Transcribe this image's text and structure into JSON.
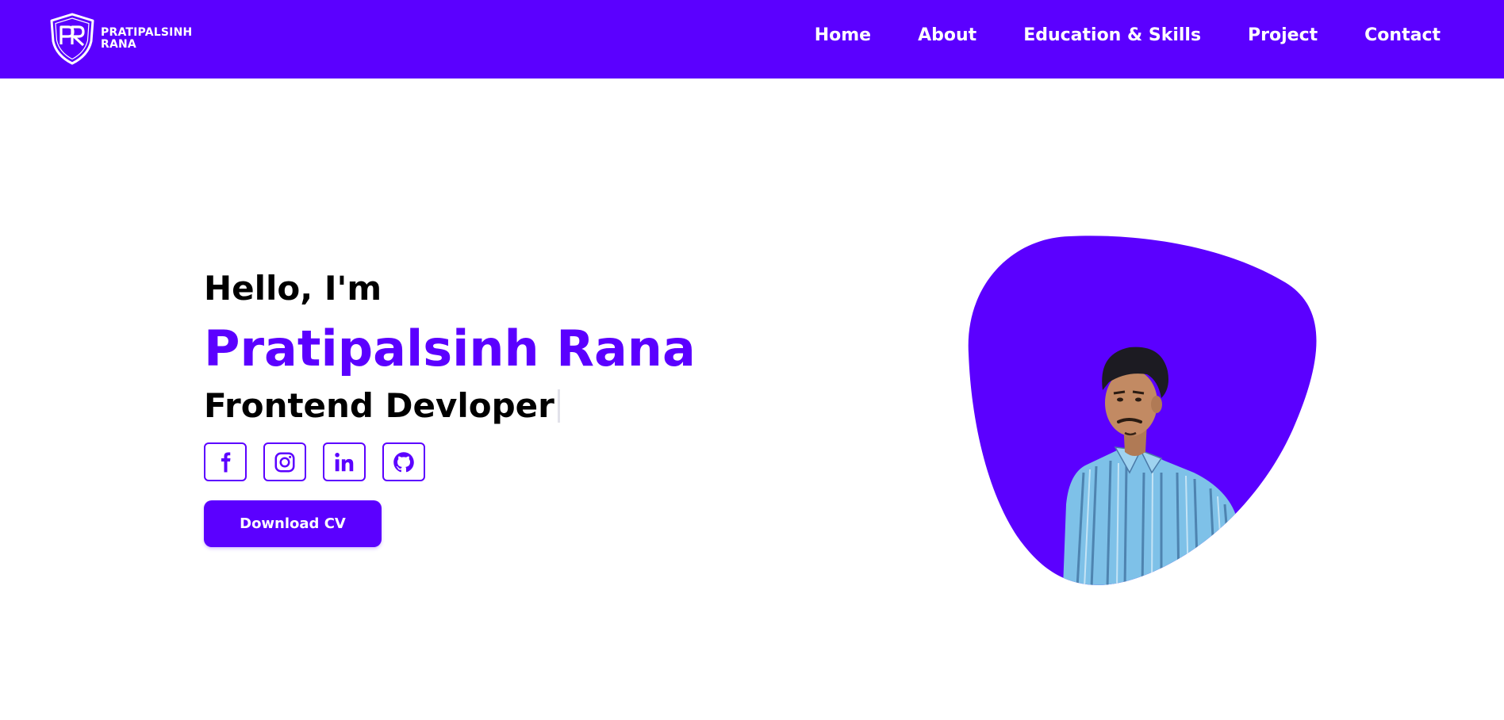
{
  "brand": {
    "monogram": "PR",
    "line1": "PRATIPALSINH",
    "line2": "RANA"
  },
  "nav": {
    "items": [
      {
        "label": "Home"
      },
      {
        "label": "About"
      },
      {
        "label": "Education & Skills"
      },
      {
        "label": "Project"
      },
      {
        "label": "Contact"
      }
    ]
  },
  "hero": {
    "greeting": "Hello, I'm",
    "name": "Pratipalsinh Rana",
    "role": "Frontend Devloper",
    "cv_button": "Download CV",
    "socials": [
      {
        "icon": "facebook-icon"
      },
      {
        "icon": "instagram-icon"
      },
      {
        "icon": "linkedin-icon"
      },
      {
        "icon": "github-icon"
      }
    ],
    "photo": "portrait-photo"
  },
  "colors": {
    "accent": "#5b00ff",
    "text": "#000000",
    "background": "#ffffff"
  }
}
